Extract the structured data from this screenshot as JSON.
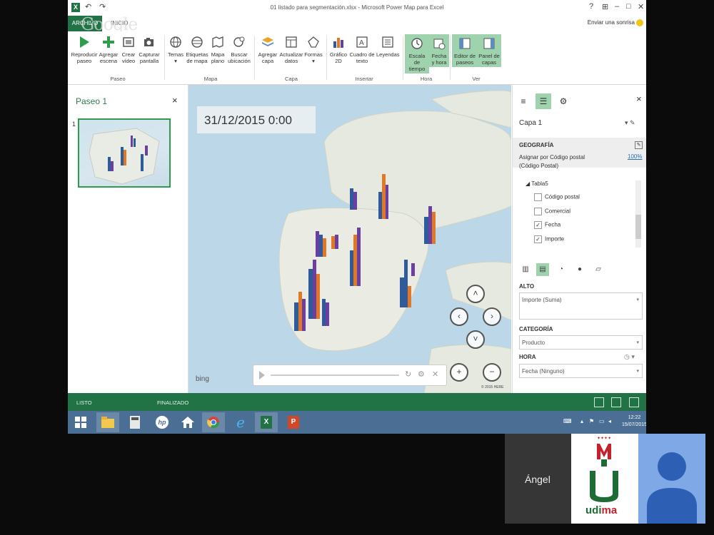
{
  "titlebar": {
    "title": "01 listado para segmentación.xlsx - Microsoft Power Map para Excel",
    "window_controls": [
      "?",
      "⊞",
      "–",
      "□",
      "✕"
    ]
  },
  "tabs": {
    "file": "ARCHIVO",
    "home": "INICIO",
    "watermark": "Google",
    "smile": "Enviar una sonrisa"
  },
  "ribbon": {
    "buttons": [
      {
        "label1": "Reproducir",
        "label2": "paseo"
      },
      {
        "label1": "Agregar",
        "label2": "escena"
      },
      {
        "label1": "Crear",
        "label2": "vídeo"
      },
      {
        "label1": "Capturar",
        "label2": "pantalla"
      },
      {
        "label1": "Temas",
        "label2": "▾"
      },
      {
        "label1": "Etiquetas",
        "label2": "de mapa"
      },
      {
        "label1": "Mapa",
        "label2": "plano"
      },
      {
        "label1": "Buscar",
        "label2": "ubicación"
      },
      {
        "label1": "Agregar",
        "label2": "capa"
      },
      {
        "label1": "Actualizar",
        "label2": "datos"
      },
      {
        "label1": "Formas",
        "label2": "▾"
      },
      {
        "label1": "Gráfico",
        "label2": "2D"
      },
      {
        "label1": "Cuadro de",
        "label2": "texto"
      },
      {
        "label1": "Leyendas",
        "label2": ""
      },
      {
        "label1": "Escala de",
        "label2": "tiempo"
      },
      {
        "label1": "Fecha",
        "label2": "y hora"
      },
      {
        "label1": "Editor de",
        "label2": "paseos"
      },
      {
        "label1": "Panel de",
        "label2": "capas"
      }
    ],
    "groups": [
      "Paseo",
      "Mapa",
      "Capa",
      "Insertar",
      "Hora",
      "Ver"
    ]
  },
  "tour_pane": {
    "title": "Paseo 1",
    "close": "×",
    "scene_number": "1"
  },
  "map": {
    "timestamp": "31/12/2015 0:00",
    "bing": "bing",
    "copyright": "© 2015 HERE",
    "nav": {
      "up": "˄",
      "left": "‹",
      "right": "›",
      "down": "˅",
      "zoom_in": "+",
      "zoom_out": "−"
    },
    "player": {
      "refresh": "↻",
      "settings": "⚙",
      "close": "✕"
    },
    "bar_colors": [
      "#2f5b9b",
      "#e07828",
      "#6b3fa0"
    ]
  },
  "layer_pane": {
    "close": "×",
    "layer_name": "Capa 1",
    "layer_ctrl": "▾ ✎",
    "geo_heading": "GEOGRAFÍA",
    "geo_line1": "Asignar por Código postal",
    "geo_line2": "(Código Postal)",
    "geo_pct": "100%",
    "table_name": "Tabla5",
    "fields": [
      {
        "label": "Código postal",
        "mark": ""
      },
      {
        "label": "Comercial",
        "mark": ""
      },
      {
        "label": "Fecha",
        "mark": "✓"
      },
      {
        "label": "Importe",
        "mark": "✓"
      }
    ],
    "alto_heading": "ALTO",
    "alto_value": "Importe (Suma)",
    "categoria_heading": "CATEGORÍA",
    "categoria_value": "Producto",
    "hora_heading": "HORA",
    "hora_value": "Fecha (Ninguno)",
    "dropdown_arrow": "▾"
  },
  "status": {
    "left": "LISTO",
    "middle": "FINALIZADO"
  },
  "taskbar": {
    "time": "12:22",
    "date": "15/07/2015",
    "excel_letter": "X",
    "ppt_letter": "P",
    "hp": "hp"
  },
  "video": {
    "name": "Ángel",
    "logo_left": "udi",
    "logo_right": "ma",
    "logo_m": "M",
    "logo_u": "U"
  }
}
